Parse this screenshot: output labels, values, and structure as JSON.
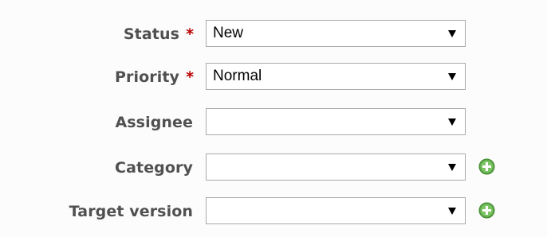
{
  "form": {
    "required_marker": "*",
    "fields": [
      {
        "label": "Status",
        "required": true,
        "value": "New",
        "add_button": false
      },
      {
        "label": "Priority",
        "required": true,
        "value": "Normal",
        "add_button": false
      },
      {
        "label": "Assignee",
        "required": false,
        "value": "",
        "add_button": false
      },
      {
        "label": "Category",
        "required": false,
        "value": "",
        "add_button": true
      },
      {
        "label": "Target version",
        "required": false,
        "value": "",
        "add_button": true
      }
    ],
    "colors": {
      "label": "#505050",
      "required": "#bb0000",
      "select_border": "#a9a9a9",
      "add_icon": "#5fa84a"
    },
    "icons": {
      "dropdown": "triangle-down-icon",
      "add": "add-circle-icon"
    }
  }
}
